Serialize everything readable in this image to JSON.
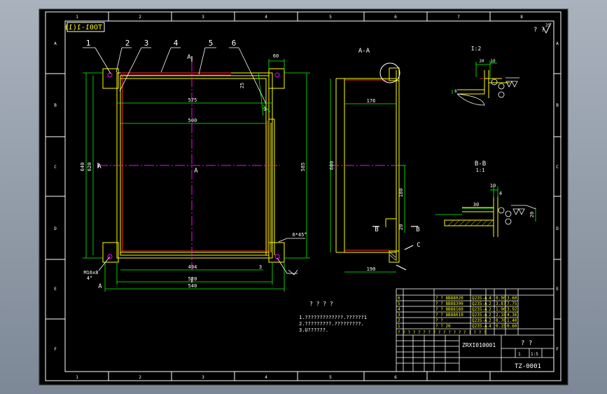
{
  "colors": {
    "frame": "#ffffff",
    "yellow": "#ffff00",
    "green": "#00ff00",
    "magenta": "#ff00ff",
    "red": "#ff3030",
    "cyan": "#00ffff"
  },
  "drawing_code_mirrored": "TO01-1(1)",
  "top_right_mark": "? ?",
  "top_right_roughness": "25",
  "border_cols": [
    "1",
    "2",
    "3",
    "4",
    "5",
    "6",
    "7",
    "8"
  ],
  "border_rows": [
    "A",
    "B",
    "C",
    "D",
    "E",
    "F"
  ],
  "balloons": [
    "1",
    "2",
    "3",
    "4",
    "5",
    "6"
  ],
  "section_labels": {
    "aa_title": "A-A",
    "a_top": "A",
    "a_left": "A",
    "a_center": "A",
    "a_bottom": "A",
    "detail_title": "I:2",
    "bb_title": "B-B",
    "bb_scale": "1:1",
    "b_left": "B",
    "b_right": "B",
    "c_label": "C"
  },
  "dims": {
    "d60": "60",
    "d575": "575",
    "d500": "500",
    "d640": "640",
    "d620": "620",
    "d585": "585",
    "d494": "494",
    "d520": "520",
    "d540": "540",
    "d176": "176",
    "d600": "600",
    "d180": "180",
    "d20": "20",
    "d190": "190",
    "d3": "3",
    "d25": "25",
    "d9": "9",
    "chamfer": "6*45°",
    "thread": "M16x8",
    "thread_angle": "4°",
    "det_20": "20",
    "det_10": "10",
    "det_6": "6",
    "bb_10": "10",
    "bb_4": "4",
    "bb_30": "30",
    "bb_20": "20"
  },
  "notes": {
    "title": "? ? ? ?",
    "line1": "1.?????????????.??????1",
    "line2": "2.?????????.?????????.",
    "line3": "3.U??????."
  },
  "bom_rows": [
    {
      "no": "6",
      "code": "? ?  8B88020",
      "mat": "Q235-A",
      "qty": "4",
      "wt": "0.90",
      "w2": "3.60"
    },
    {
      "no": "5",
      "code": "? ?  8B88300",
      "mat": "Q235-A",
      "qty": "2",
      "wt": "3.87",
      "w2": "7.75"
    },
    {
      "no": "4",
      "code": "? ?  8B88160",
      "mat": "Q235-A",
      "qty": "2",
      "wt": "1.96",
      "w2": "3.92"
    },
    {
      "no": "3",
      "code": "? ?  8B88010",
      "mat": "Q235-A",
      "qty": "2",
      "wt": "2.18",
      "w2": "4.36"
    },
    {
      "no": "2",
      "code": "? ?",
      "mat": "Q235-A",
      "qty": "2",
      "wt": "0.70",
      "w2": "1.40"
    },
    {
      "no": "1",
      "code": "? ?  20",
      "mat": "Q235-A",
      "qty": "4",
      "wt": "0.15",
      "w2": "0.60"
    }
  ],
  "bom_header": "? ? ? ? ? ? ? ? ? ? ? ? ? ? ? ? ? ?",
  "title_block": {
    "drawing_no": "ZRXI010001",
    "name": "? ?",
    "code": "TZ-0001",
    "scale": "1:5",
    "sheet": "1"
  }
}
